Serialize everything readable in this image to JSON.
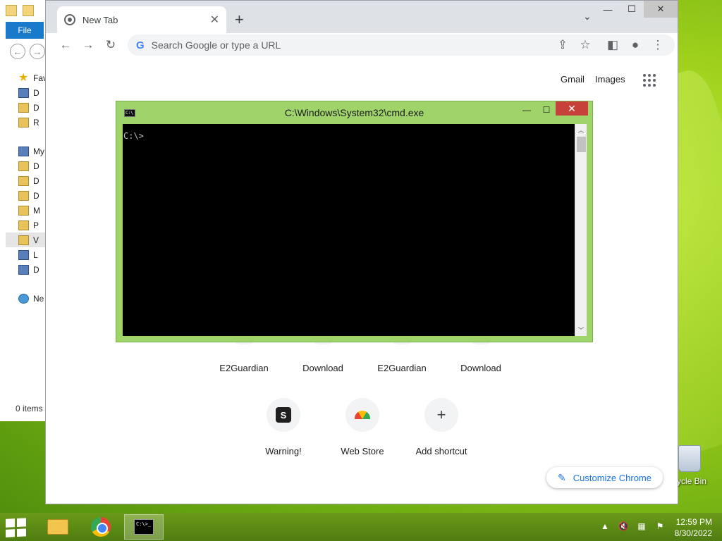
{
  "explorer": {
    "file_tab": "File",
    "tree": [
      {
        "label": "Fav",
        "icon": "star-icon"
      },
      {
        "label": "D",
        "icon": "desktop-icon"
      },
      {
        "label": "D",
        "icon": "downloads-icon"
      },
      {
        "label": "R",
        "icon": "recent-places-icon"
      },
      {
        "label": "My",
        "icon": "computer-icon"
      },
      {
        "label": "D",
        "icon": "folder-icon"
      },
      {
        "label": "D",
        "icon": "folder-icon"
      },
      {
        "label": "D",
        "icon": "folder-icon"
      },
      {
        "label": "M",
        "icon": "music-folder-icon"
      },
      {
        "label": "P",
        "icon": "pictures-folder-icon"
      },
      {
        "label": "V",
        "icon": "videos-folder-icon"
      },
      {
        "label": "L",
        "icon": "drive-icon"
      },
      {
        "label": "D",
        "icon": "drive-icon"
      },
      {
        "label": "Ne",
        "icon": "network-icon"
      }
    ],
    "status": "0 items"
  },
  "chrome": {
    "tab_title": "New Tab",
    "tab_close": "✕",
    "new_tab": "+",
    "tab_dropdown": "⌄",
    "omnibox_placeholder": "Search Google or type a URL",
    "g_logo": "G",
    "header_links": {
      "gmail": "Gmail",
      "images": "Images"
    },
    "shortcuts_row1": [
      "E2Guardian",
      "Download",
      "E2Guardian",
      "Download"
    ],
    "shortcuts_row2": [
      {
        "label": "Warning!",
        "icon": "s-icon",
        "glyph": "S"
      },
      {
        "label": "Web Store",
        "icon": "web-store-icon",
        "glyph": ""
      },
      {
        "label": "Add shortcut",
        "icon": "plus-icon",
        "glyph": "+"
      }
    ],
    "customize_label": "Customize Chrome"
  },
  "cmd": {
    "title": "C:\\Windows\\System32\\cmd.exe",
    "icon_text": "C:\\",
    "prompt": "C:\\>",
    "min_glyph": "—",
    "max_glyph": "☐",
    "close_glyph": "✕"
  },
  "desktop": {
    "recycle_bin_label": "ycle Bin"
  },
  "taskbar": {
    "cmd_icon_text": "C:\\>_",
    "time": "12:59 PM",
    "date": "8/30/2022"
  },
  "colors": {
    "cmd_frame": "#9fd46b",
    "cmd_close": "#c8403a",
    "taskbar": "#5a8a14",
    "accent_blue": "#1a73e8"
  }
}
